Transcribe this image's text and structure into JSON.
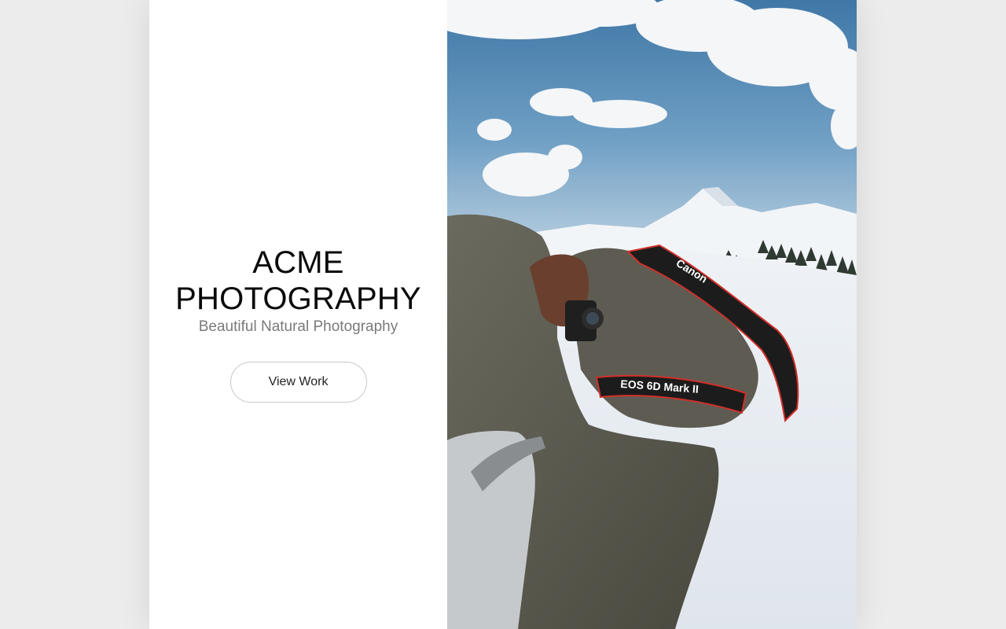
{
  "hero": {
    "title_line1": "ACME",
    "title_line2": "PHOTOGRAPHY",
    "subtitle": "Beautiful Natural Photography",
    "cta_label": "View Work"
  },
  "photo": {
    "strap_brand": "Canon",
    "strap_model": "EOS 6D Mark II"
  },
  "colors": {
    "background": "#ececec",
    "panel": "#ffffff",
    "title": "#0a0a0a",
    "subtitle": "#7a7a7a",
    "button_border": "#c9c9c9",
    "sky": "#4f86b0",
    "jacket": "#5c5a50",
    "strap_red": "#d0302b"
  }
}
